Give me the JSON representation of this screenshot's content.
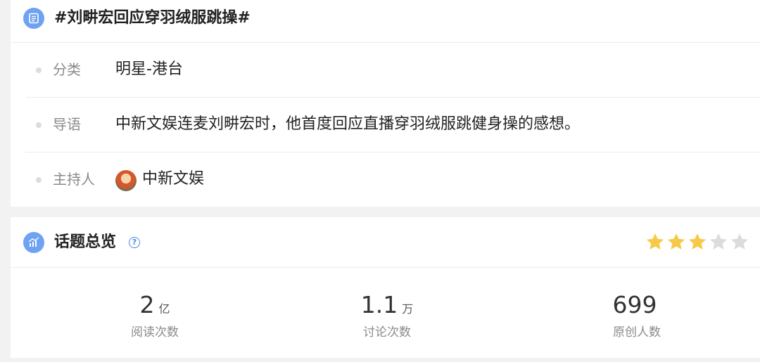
{
  "topic": {
    "title": "#刘畊宏回应穿羽绒服跳操#",
    "rows": [
      {
        "label": "分类",
        "value": "明星-港台"
      },
      {
        "label": "导语",
        "value": "中新文娱连麦刘畊宏时，他首度回应直播穿羽绒服跳健身操的感想。"
      },
      {
        "label": "主持人",
        "value": "中新文娱"
      }
    ]
  },
  "overview": {
    "title": "话题总览",
    "help_icon": "question-circle-icon",
    "rating": 3,
    "rating_max": 5,
    "star_color_on": "#f7c948",
    "star_color_off": "#dcdcdc",
    "stats": [
      {
        "number": "2",
        "unit": "亿",
        "label": "阅读次数"
      },
      {
        "number": "1.1",
        "unit": "万",
        "label": "讨论次数"
      },
      {
        "number": "699",
        "unit": "",
        "label": "原创人数"
      }
    ]
  },
  "colors": {
    "accent": "#6fa2f3",
    "link_blue": "#4a86e8"
  }
}
